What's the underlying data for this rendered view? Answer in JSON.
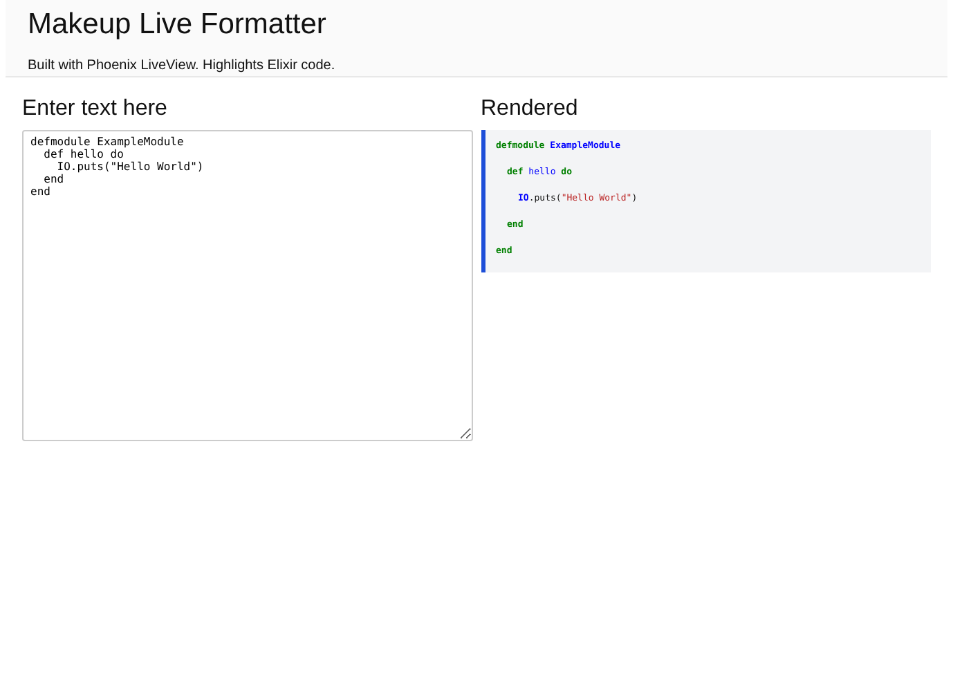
{
  "header": {
    "title": "Makeup Live Formatter",
    "subtitle": "Built with Phoenix LiveView. Highlights Elixir code."
  },
  "editor": {
    "heading": "Enter text here",
    "value": "defmodule ExampleModule\n  def hello do\n    IO.puts(\"Hello World\")\n  end\nend"
  },
  "rendered": {
    "heading": "Rendered",
    "lines": [
      {
        "tokens": [
          {
            "kind": "keyword",
            "text": "defmodule",
            "spaced": false
          },
          {
            "kind": "module",
            "text": "ExampleModule",
            "spaced": true
          }
        ],
        "children": [
          {
            "tokens": [
              {
                "kind": "keyword",
                "text": "def",
                "spaced": false
              },
              {
                "kind": "name",
                "text": "hello",
                "spaced": true
              },
              {
                "kind": "keyword",
                "text": "do",
                "spaced": true
              }
            ],
            "children": [
              {
                "tokens": [
                  {
                    "kind": "module",
                    "text": "IO",
                    "spaced": false
                  },
                  {
                    "kind": "plain",
                    "text": ".puts(",
                    "spaced": false
                  },
                  {
                    "kind": "string",
                    "text": "\"Hello World\"",
                    "spaced": false
                  },
                  {
                    "kind": "plain",
                    "text": ")",
                    "spaced": false
                  }
                ]
              }
            ]
          },
          {
            "tokens": [
              {
                "kind": "keyword",
                "text": "end",
                "spaced": false
              }
            ]
          }
        ]
      },
      {
        "tokens": [
          {
            "kind": "keyword",
            "text": "end",
            "spaced": false
          }
        ]
      }
    ]
  }
}
